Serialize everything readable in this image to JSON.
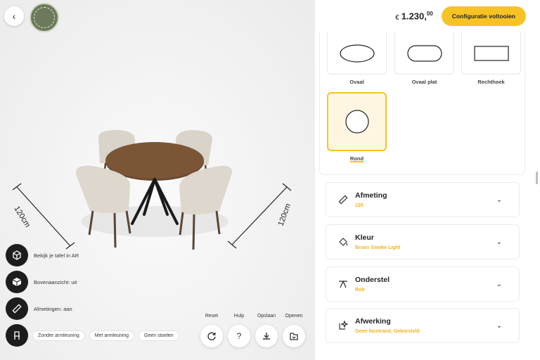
{
  "header": {
    "price_currency": "€",
    "price_main": "1.230,",
    "price_cents": "00",
    "cta_label": "Configuratie voltooien"
  },
  "dimensions": {
    "left": "120cm",
    "right": "120cm"
  },
  "side_actions": [
    {
      "label": "Bekijk je tafel in AR",
      "icon": "ar-cube-icon"
    },
    {
      "label": "Bovenaanzicht: uit",
      "icon": "box-icon"
    },
    {
      "label": "Afmetingen: aan",
      "icon": "ruler-icon"
    },
    {
      "label": "",
      "icon": "chair-icon"
    }
  ],
  "chair_chips": [
    "Zonder armleuning",
    "Met armleuning",
    "Geen stoelen"
  ],
  "tools": [
    {
      "label": "Reset",
      "icon": "reset-icon"
    },
    {
      "label": "Hulp",
      "icon": "help-icon"
    },
    {
      "label": "Opslaan",
      "icon": "download-icon"
    },
    {
      "label": "Openen",
      "icon": "open-folder-icon"
    }
  ],
  "shapes": [
    {
      "label": "Ovaal",
      "selected": false
    },
    {
      "label": "Ovaal plat",
      "selected": false
    },
    {
      "label": "Rechthoek",
      "selected": false
    },
    {
      "label": "Rond",
      "selected": true
    }
  ],
  "options": [
    {
      "title": "Afmeting",
      "value": "120",
      "icon": "ruler-icon"
    },
    {
      "title": "Kleur",
      "value": "Bruen Smoke Light",
      "icon": "paint-bucket-icon"
    },
    {
      "title": "Onderstel",
      "value": "Rob",
      "icon": "table-base-icon"
    },
    {
      "title": "Afwerking",
      "value": "Geen facetrand, Geborsteld",
      "icon": "sparkle-edit-icon"
    }
  ],
  "colors": {
    "accent": "#f7c324",
    "accent_text": "#f0b418",
    "dark_button": "#1d1d1d",
    "wood": "#6b4a30"
  }
}
